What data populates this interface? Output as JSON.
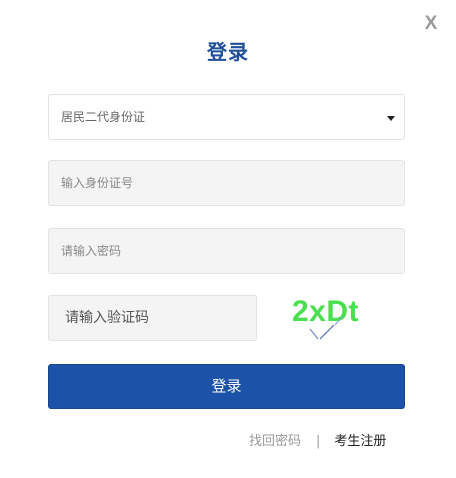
{
  "window": {
    "close_label": "X"
  },
  "header": {
    "title": "登录"
  },
  "form": {
    "id_type_selected": "居民二代身份证",
    "id_number_placeholder": "输入身份证号",
    "password_placeholder": "请输入密码",
    "captcha_placeholder": "请输入验证码",
    "captcha_code": "2xDt",
    "submit_label": "登录"
  },
  "footer": {
    "forgot_password": "找回密码",
    "separator": "|",
    "register": "考生注册"
  },
  "colors": {
    "accent": "#1c53a8",
    "title": "#1e4f99",
    "captcha_text": "#48e04e"
  },
  "icons": {
    "select_caret": "caret-down-icon",
    "close": "close-icon"
  }
}
